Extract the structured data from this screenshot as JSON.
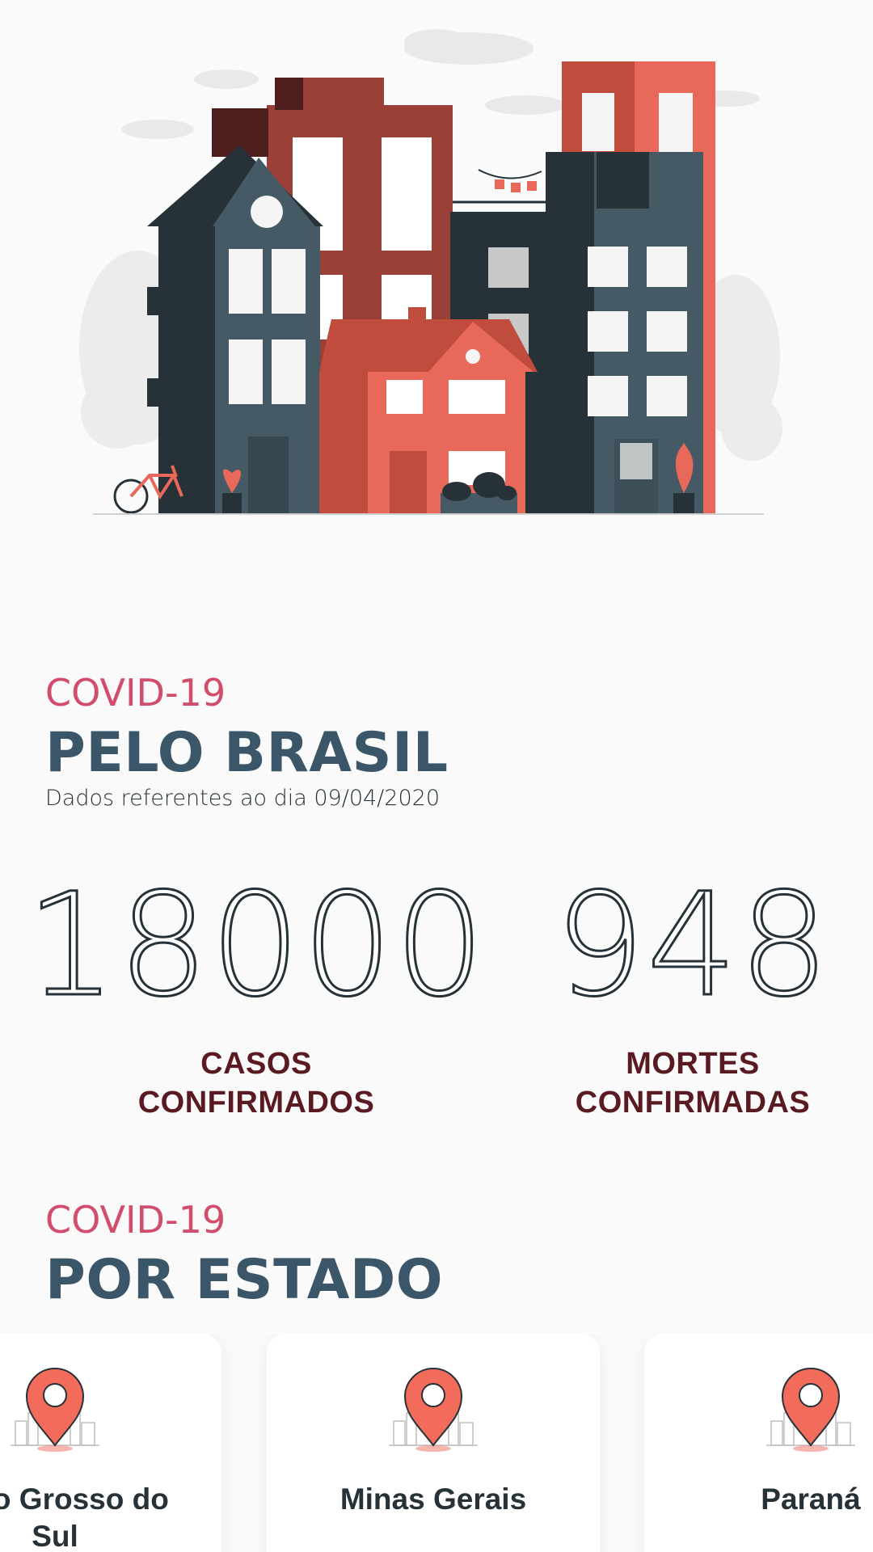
{
  "brasil": {
    "kicker": "COVID-19",
    "title": "PELO BRASIL",
    "subtitle": "Dados referentes ao dia 09/04/2020"
  },
  "stats": [
    {
      "value": "18000",
      "label_line1": "CASOS",
      "label_line2": "CONFIRMADOS"
    },
    {
      "value": "948",
      "label_line1": "MORTES",
      "label_line2": "CONFIRMADAS"
    }
  ],
  "estado": {
    "kicker": "COVID-19",
    "title": "POR ESTADO"
  },
  "states": [
    {
      "name_line1": "Mato Grosso do",
      "name_line2": "Sul"
    },
    {
      "name_line1": "Minas Gerais",
      "name_line2": ""
    },
    {
      "name_line1": "Paraná",
      "name_line2": ""
    }
  ],
  "colors": {
    "accent_pink": "#d14d6b",
    "title_slate": "#3a5668",
    "label_maroon": "#5a1a22",
    "pin_coral": "#f26b5b"
  },
  "icons": {
    "hero": "city-buildings-illustration",
    "card": "location-pin-city-icon"
  }
}
